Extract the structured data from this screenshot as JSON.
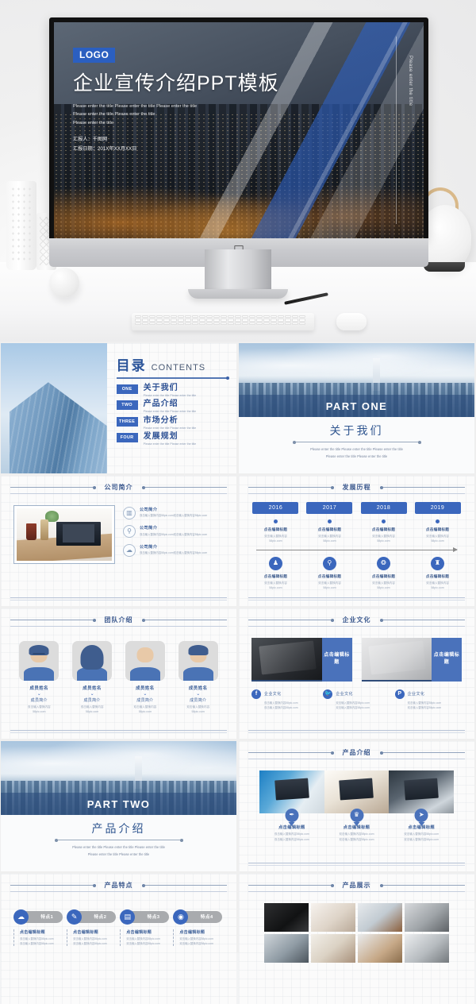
{
  "cover": {
    "logo": "LOGO",
    "title": "企业宣传介绍PPT模板",
    "subtitle_lines": [
      "Please enter the title Please enter the title Please enter the title",
      "Please enter the title Please enter the title",
      "Please enter the title"
    ],
    "presenter": "汇报人：千图网",
    "date": "汇报日期：201X年XX月XX日",
    "vertical_text": "Please enter the title"
  },
  "contents": {
    "title_cn": "目录",
    "title_en": "CONTENTS",
    "items": [
      {
        "num": "ONE",
        "label": "关于我们",
        "desc": "Please enter the title Please enter the title"
      },
      {
        "num": "TWO",
        "label": "产品介绍",
        "desc": "Please enter the title Please enter the title"
      },
      {
        "num": "THREE",
        "label": "市场分析",
        "desc": "Please enter the title Please enter the title"
      },
      {
        "num": "FOUR",
        "label": "发展规划",
        "desc": "Please enter the title Please enter the title"
      }
    ]
  },
  "part_one": {
    "band": "PART ONE",
    "title_cn": "关于我们",
    "desc_line1": "Please enter the title Please enter the title Please enter the title",
    "desc_line2": "Please enter the title Please enter the title"
  },
  "part_two": {
    "band": "PART TWO",
    "title_cn": "产品介绍",
    "desc_line1": "Please enter the title Please enter the title Please enter the title",
    "desc_line2": "Please enter the title Please enter the title"
  },
  "profile": {
    "section_title": "公司简介",
    "items": [
      {
        "icon": "chart-bar-icon",
        "glyph": "▥",
        "title": "公司简介",
        "desc": "双击输入替换内容58pic.com双击输入替换内容58pic.com"
      },
      {
        "icon": "search-icon",
        "glyph": "⚲",
        "title": "公司简介",
        "desc": "双击输入替换内容58pic.com双击输入替换内容58pic.com"
      },
      {
        "icon": "cloud-icon",
        "glyph": "☁",
        "title": "公司简介",
        "desc": "双击输入替换内容58pic.com双击输入替换内容58pic.com"
      }
    ]
  },
  "timeline": {
    "section_title": "发展历程",
    "years": [
      "2016",
      "2017",
      "2018",
      "2019"
    ],
    "top_items": [
      {
        "title": "点击编辑标题",
        "desc": "双击输入替换内容",
        "site": "58pic.com"
      },
      {
        "title": "点击编辑标题",
        "desc": "双击输入替换内容",
        "site": "58pic.com"
      },
      {
        "title": "点击编辑标题",
        "desc": "双击输入替换内容",
        "site": "58pic.com"
      },
      {
        "title": "点击编辑标题",
        "desc": "双击输入替换内容",
        "site": "58pic.com"
      }
    ],
    "bottom_items": [
      {
        "icon": "users-icon",
        "glyph": "♟",
        "title": "点击编辑标题",
        "desc": "双击输入替换内容",
        "site": "58pic.com"
      },
      {
        "icon": "search-icon",
        "glyph": "⚲",
        "title": "点击编辑标题",
        "desc": "双击输入替换内容",
        "site": "58pic.com"
      },
      {
        "icon": "gear-icon",
        "glyph": "❂",
        "title": "点击编辑标题",
        "desc": "双击输入替换内容",
        "site": "58pic.com"
      },
      {
        "icon": "trophy-icon",
        "glyph": "♜",
        "title": "点击编辑标题",
        "desc": "双击输入替换内容",
        "site": "58pic.com"
      }
    ]
  },
  "team": {
    "section_title": "团队介绍",
    "members": [
      {
        "avatar": "avatar-man-glasses",
        "name": "成员姓名",
        "chevron": "⌄",
        "role": "成员简介",
        "desc": "双击输入替换内容",
        "site": "58pic.com"
      },
      {
        "avatar": "avatar-woman-long",
        "name": "成员姓名",
        "chevron": "⌄",
        "role": "成员简介",
        "desc": "双击输入替换内容",
        "site": "58pic.com"
      },
      {
        "avatar": "avatar-man-bald",
        "name": "成员姓名",
        "chevron": "⌄",
        "role": "成员简介",
        "desc": "双击输入替换内容",
        "site": "58pic.com"
      },
      {
        "avatar": "avatar-woman-short",
        "name": "成员姓名",
        "chevron": "⌄",
        "role": "成员简介",
        "desc": "双击输入替换内容",
        "site": "58pic.com"
      }
    ]
  },
  "culture": {
    "section_title": "企业文化",
    "cards": [
      {
        "photo": "laptop-notebook-dark",
        "tag": "点击编辑标题"
      },
      {
        "photo": "desk-gadgets-gray",
        "tag": "点击编辑标题"
      }
    ],
    "socials": [
      {
        "icon": "facebook-icon",
        "glyph": "f",
        "title": "企业文化",
        "line1": "双击输入替换内容58pic.com",
        "line2": "双击输入替换内容58pic.com"
      },
      {
        "icon": "twitter-icon",
        "glyph": "🐦",
        "title": "企业文化",
        "line1": "双击输入替换内容58pic.com",
        "line2": "双击输入替换内容58pic.com"
      },
      {
        "icon": "pinterest-icon",
        "glyph": "P",
        "title": "企业文化",
        "line1": "双击输入替换内容58pic.com",
        "line2": "双击输入替换内容58pic.com"
      }
    ]
  },
  "product_intro": {
    "section_title": "产品介绍",
    "items": [
      {
        "photo": "blue-laptop",
        "icon": "tag-icon",
        "glyph": "✒",
        "title": "点击编辑标题",
        "line1": "双击输入替换内容58pic.com",
        "line2": "双击输入替换内容58pic.com"
      },
      {
        "photo": "desk-typing",
        "icon": "trophy-icon",
        "glyph": "♛",
        "title": "点击编辑标题",
        "line1": "双击输入替换内容58pic.com",
        "line2": "双击输入替换内容58pic.com"
      },
      {
        "photo": "monitor-design",
        "icon": "send-icon",
        "glyph": "➤",
        "title": "点击编辑标题",
        "line1": "双击输入替换内容58pic.com",
        "line2": "双击输入替换内容58pic.com"
      }
    ]
  },
  "features": {
    "section_title": "产品特点",
    "items": [
      {
        "icon": "cloud-icon",
        "glyph": "☁",
        "label": "特点1",
        "title": "点击编辑标题",
        "line1": "双击输入替换内容58pic.com",
        "line2": "双击输入替换内容58pic.com"
      },
      {
        "icon": "pen-icon",
        "glyph": "✎",
        "label": "特点2",
        "title": "点击编辑标题",
        "line1": "双击输入替换内容58pic.com",
        "line2": "双击输入替换内容58pic.com"
      },
      {
        "icon": "folder-icon",
        "glyph": "▤",
        "label": "特点3",
        "title": "点击编辑标题",
        "line1": "双击输入替换内容58pic.com",
        "line2": "双击输入替换内容58pic.com"
      },
      {
        "icon": "eye-icon",
        "glyph": "◉",
        "label": "特点4",
        "title": "点击编辑标题",
        "line1": "双击输入替换内容58pic.com",
        "line2": "双击输入替换内容58pic.com"
      }
    ]
  },
  "gallery": {
    "section_title": "产品展示",
    "tiles": [
      "desk-dark-laptop",
      "flowers-desk",
      "imac-workspace",
      "keyboard-mono",
      "laptop-closeup",
      "notebook-pen",
      "wood-desk",
      "printer-gray"
    ]
  },
  "colors": {
    "accent_blue": "#3b67bd",
    "deep_blue": "#2a5399",
    "band_blue": "#2f4c79",
    "muted_gray": "#a9abae",
    "page_bg": "#efefef"
  }
}
